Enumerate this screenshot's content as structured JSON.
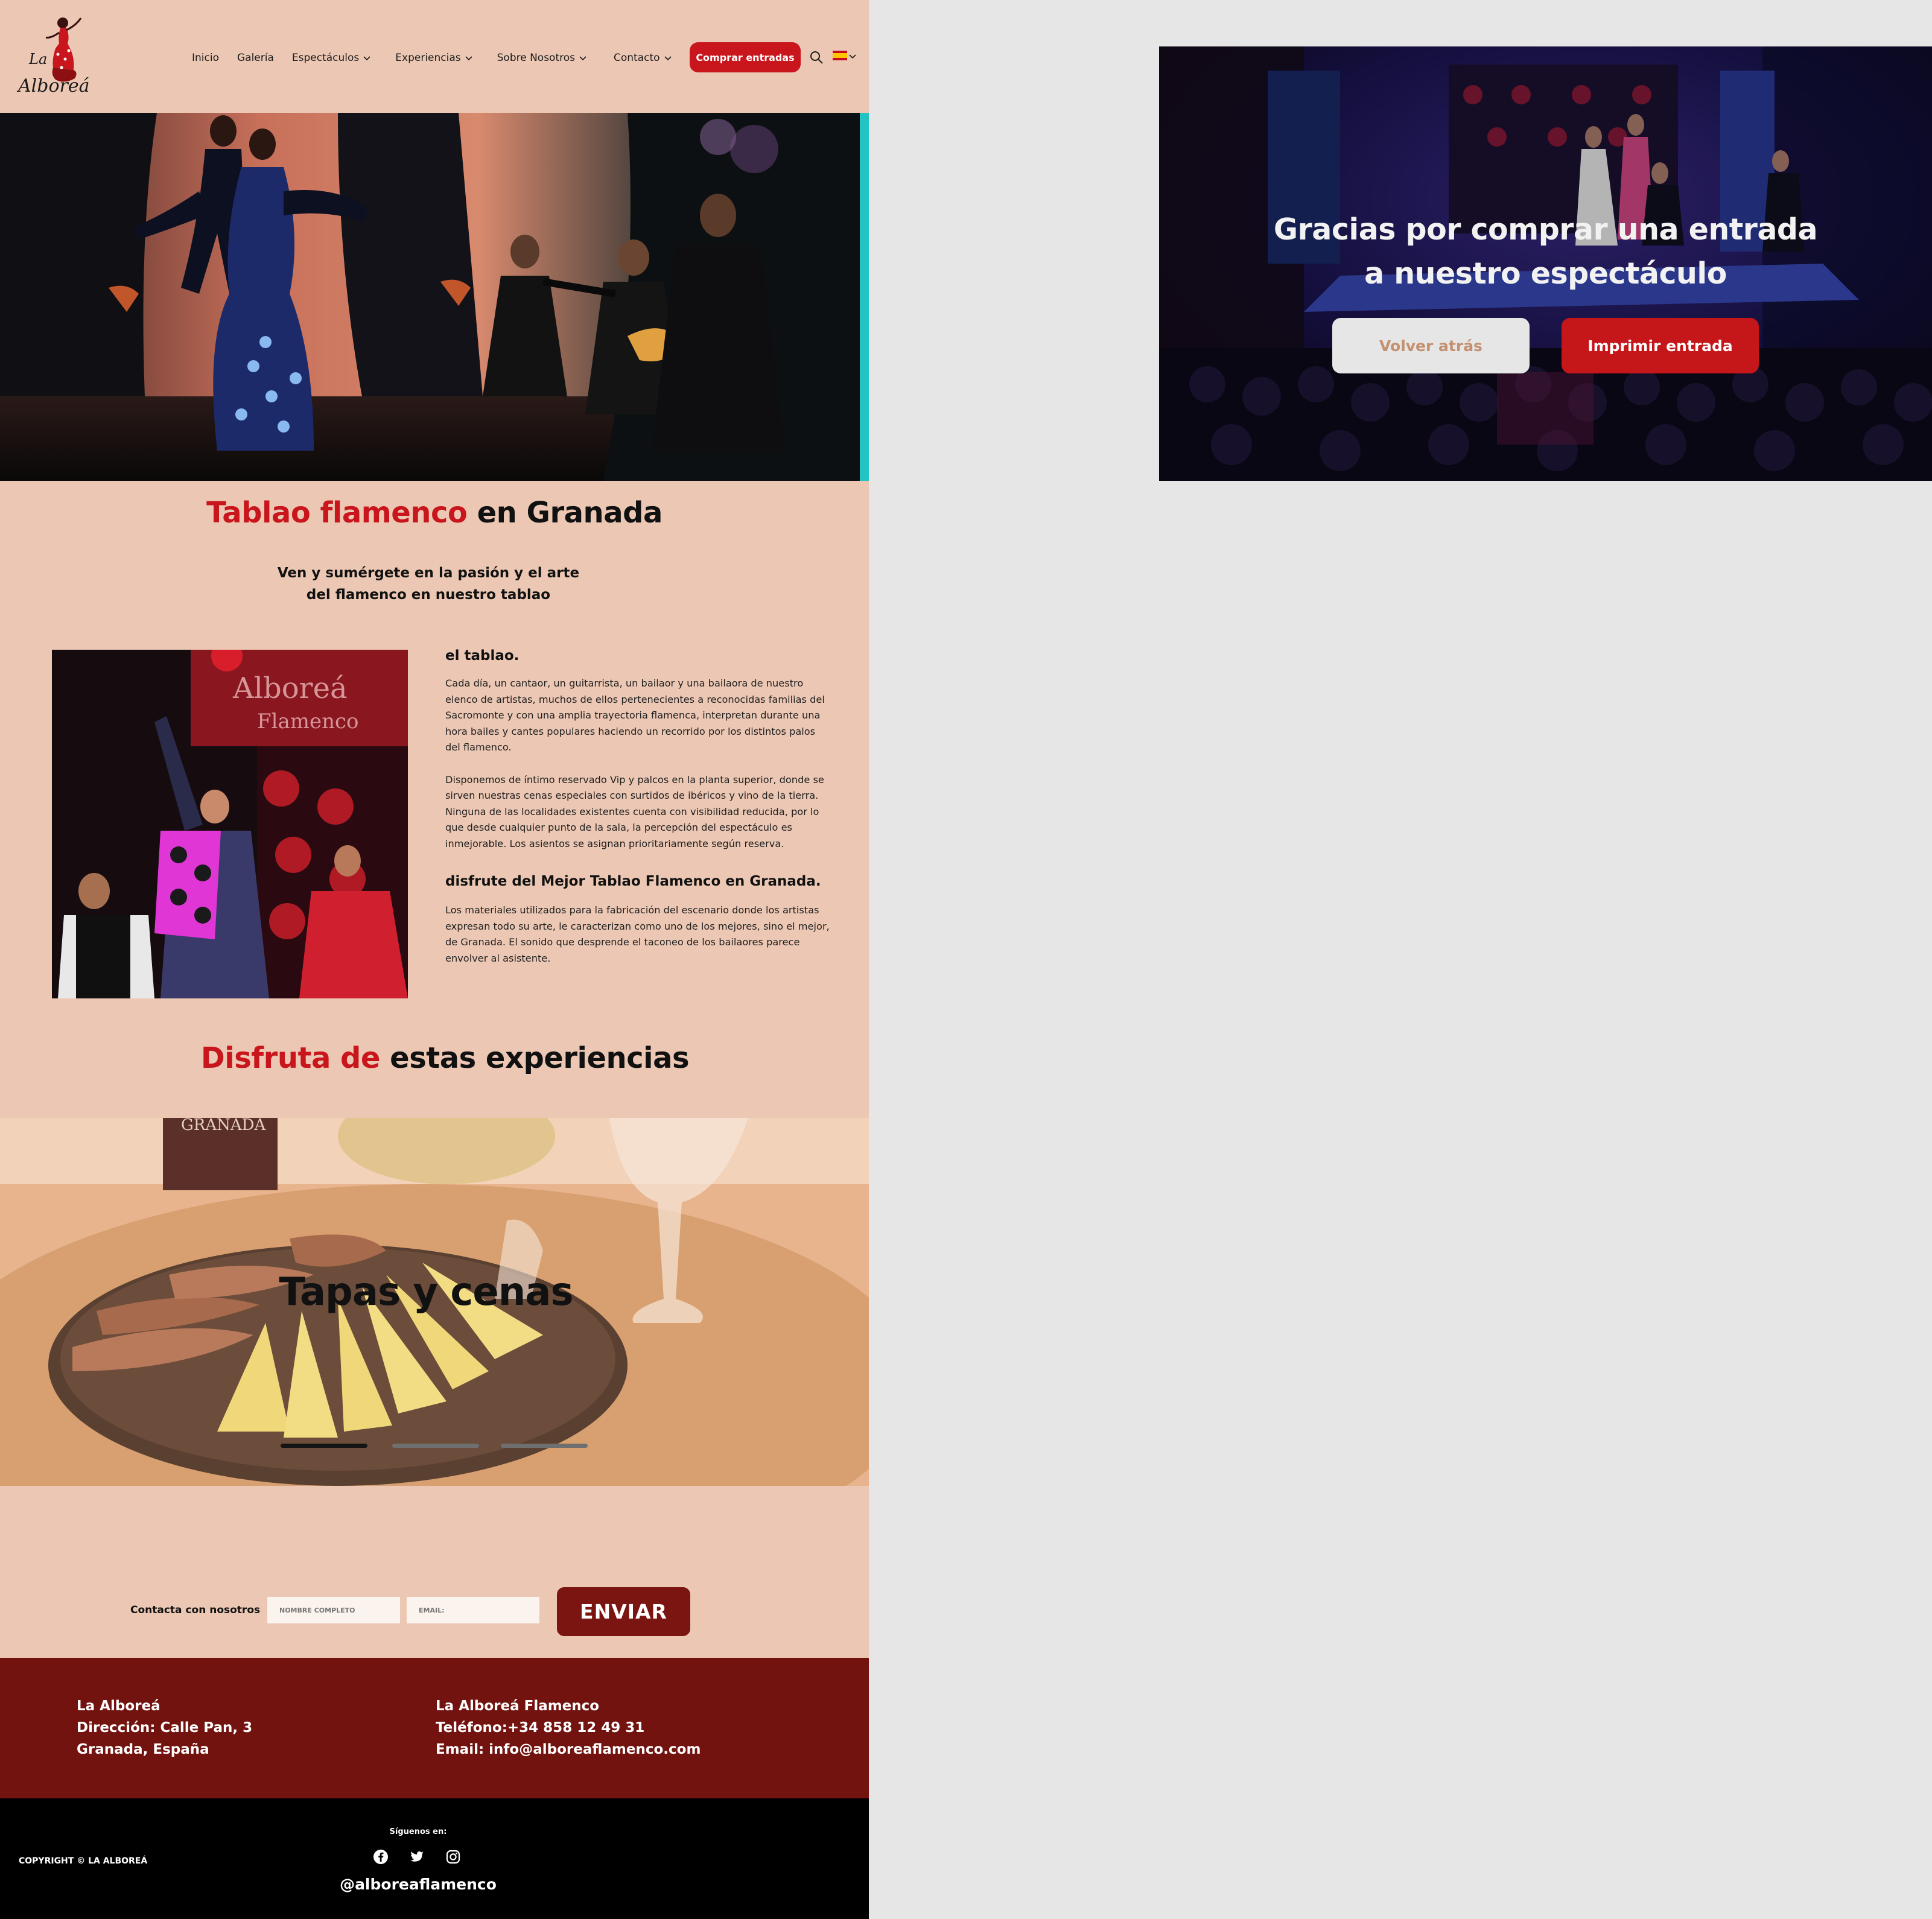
{
  "header": {
    "logo_text_top": "La",
    "logo_text_bottom": "Alboreá",
    "nav": [
      {
        "label": "Inicio"
      },
      {
        "label": "Galería"
      },
      {
        "label": "Espectáculos"
      },
      {
        "label": "Experiencias"
      },
      {
        "label": "Sobre Nosotros"
      },
      {
        "label": "Contacto"
      }
    ],
    "buy_button": "Comprar entradas",
    "language": "ES"
  },
  "intro": {
    "title_red": "Tablao flamenco",
    "title_black": " en Granada",
    "subtitle_line1": "Ven y sumérgete en la pasión y el arte",
    "subtitle_line2": "del flamenco en nuestro tablao"
  },
  "tablao": {
    "heading": "el tablao.",
    "p1": "Cada día, un cantaor, un guitarrista, un bailaor y una bailaora de nuestro elenco de artistas, muchos de ellos pertenecientes a reconocidas familias del Sacromonte y con una amplia trayectoria flamenca, interpretan durante una hora bailes y cantes populares haciendo un recorrido por los distintos palos del flamenco.",
    "p2": "Disponemos de íntimo reservado Vip y palcos en la planta superior, donde se sirven nuestras cenas especiales con surtidos de ibéricos y vino de la tierra. Ninguna de las localidades existentes cuenta con visibilidad reducida, por lo que desde cualquier punto de la sala, la percepción del espectáculo es inmejorable. Los asientos se asignan prioritariamente según reserva.",
    "heading2": "disfrute del Mejor Tablao Flamenco en Granada.",
    "p3": "Los materiales utilizados para la fabricación del escenario donde los artistas expresan todo su arte, le caracterizan como uno de los mejores, sino el mejor, de Granada. El sonido que desprende el taconeo de los bailaores parece envolver al asistente."
  },
  "experiences": {
    "title_red": "Disfruta de",
    "title_black": " estas experiencias",
    "slide_label": "Tapas y cenas",
    "slide_count": 3,
    "active_slide": 1
  },
  "contact": {
    "label": "Contacta con nosotros",
    "name_placeholder": "NOMBRE COMPLETO",
    "email_placeholder": "EMAIL:",
    "send": "ENVIAR"
  },
  "footer": {
    "col1": [
      "La Alboreá",
      "Dirección: Calle Pan, 3",
      "Granada, España"
    ],
    "col2": [
      "La Alboreá Flamenco",
      "Teléfono:+34 858 12 49 31",
      "Email: info@alboreaflamenco.com"
    ],
    "copyright": "COPYRIGHT © LA ALBOREÁ",
    "follow": "Síguenos en:",
    "socials": [
      "facebook-icon",
      "twitter-icon",
      "instagram-icon"
    ],
    "handle": "@alboreaflamenco"
  },
  "thanks": {
    "title_line1": "Gracias por comprar una entrada",
    "title_line2": "a nuestro espectáculo",
    "back": "Volver atrás",
    "print": "Imprimir entrada"
  },
  "colors": {
    "page_bg": "#ecc8b4",
    "accent_red": "#c8161c",
    "footer_red": "#73130f",
    "canvas_gray": "#e6e6e6"
  }
}
